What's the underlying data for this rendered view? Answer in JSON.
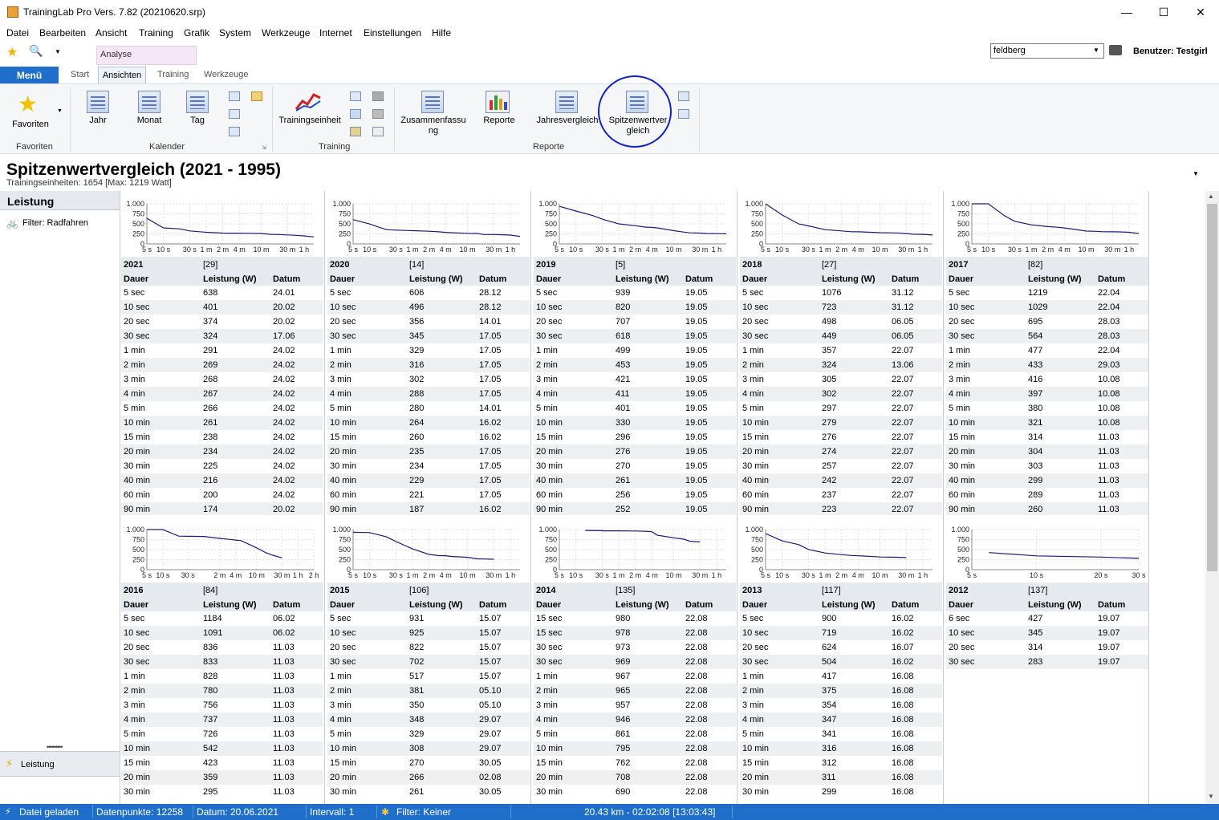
{
  "window": {
    "title": "TrainingLab Pro Vers. 7.82 (20210620.srp)"
  },
  "menu": [
    "Datei",
    "Bearbeiten",
    "Ansicht",
    "Training",
    "Grafik",
    "System",
    "Werkzeuge",
    "Internet",
    "Einstellungen",
    "Hilfe"
  ],
  "quick_access": {
    "context_tab": "Analyse"
  },
  "user": {
    "combo_value": "feldberg",
    "label": "Benutzer: Testgirl"
  },
  "tabs": {
    "menu": "Menü",
    "start": "Start",
    "ansichten": "Ansichten",
    "training": "Training",
    "werkzeuge": "Werkzeuge"
  },
  "ribbon": {
    "favoriten": "Favoriten",
    "favoriten_group": "Favoriten",
    "jahr": "Jahr",
    "monat": "Monat",
    "tag": "Tag",
    "kalender_group": "Kalender",
    "trainingseinheit": "Trainingseinheit",
    "training_group": "Training",
    "zusammenfassung_1": "Zusammenfassu",
    "zusammenfassung_2": "ng",
    "reporte": "Reporte",
    "jahresvergleich": "Jahresvergleich",
    "spitzen_1": "Spitzenwertver",
    "spitzen_2": "gleich",
    "reporte_group": "Reporte"
  },
  "page": {
    "title": "Spitzenwertvergleich (2021 - 1995)",
    "subtitle": "Trainingseinheiten: 1654 [Max: 1219 Watt]"
  },
  "sidebar": {
    "header": "Leistung",
    "filter": "Filter: Radfahren",
    "bottom": "Leistung"
  },
  "columns": {
    "dauer": "Dauer",
    "leistung": "Leistung (W)",
    "datum": "Datum"
  },
  "axis": {
    "y_ticks": [
      "1.000",
      "750",
      "500",
      "250",
      "0"
    ],
    "x_ticks": [
      "5 s",
      "10 s",
      "30 s",
      "1 m",
      "2 m",
      "4 m",
      "10 m",
      "30 m",
      "1 h"
    ],
    "x_ticks_2016": [
      "5 s",
      "10 s",
      "30 s",
      "2 m",
      "4 m",
      "10 m",
      "30 m",
      "1 h",
      "2 h"
    ],
    "x_ticks_2012": [
      "5 s",
      "10 s",
      "20 s",
      "30 s"
    ]
  },
  "cards": [
    {
      "year": "2021",
      "count": "[29]",
      "rows": [
        [
          "5 sec",
          "638",
          "24.01"
        ],
        [
          "10 sec",
          "401",
          "20.02"
        ],
        [
          "20 sec",
          "374",
          "20.02"
        ],
        [
          "30 sec",
          "324",
          "17.06"
        ],
        [
          "1 min",
          "291",
          "24.02"
        ],
        [
          "2 min",
          "269",
          "24.02"
        ],
        [
          "3 min",
          "268",
          "24.02"
        ],
        [
          "4 min",
          "267",
          "24.02"
        ],
        [
          "5 min",
          "266",
          "24.02"
        ],
        [
          "10 min",
          "261",
          "24.02"
        ],
        [
          "15 min",
          "238",
          "24.02"
        ],
        [
          "20 min",
          "234",
          "24.02"
        ],
        [
          "30 min",
          "225",
          "24.02"
        ],
        [
          "40 min",
          "216",
          "24.02"
        ],
        [
          "60 min",
          "200",
          "24.02"
        ],
        [
          "90 min",
          "174",
          "20.02"
        ]
      ]
    },
    {
      "year": "2020",
      "count": "[14]",
      "rows": [
        [
          "5 sec",
          "606",
          "28.12"
        ],
        [
          "10 sec",
          "496",
          "28.12"
        ],
        [
          "20 sec",
          "356",
          "14.01"
        ],
        [
          "30 sec",
          "345",
          "17.05"
        ],
        [
          "1 min",
          "329",
          "17.05"
        ],
        [
          "2 min",
          "316",
          "17.05"
        ],
        [
          "3 min",
          "302",
          "17.05"
        ],
        [
          "4 min",
          "288",
          "17.05"
        ],
        [
          "5 min",
          "280",
          "14.01"
        ],
        [
          "10 min",
          "264",
          "16.02"
        ],
        [
          "15 min",
          "260",
          "16.02"
        ],
        [
          "20 min",
          "235",
          "17.05"
        ],
        [
          "30 min",
          "234",
          "17.05"
        ],
        [
          "40 min",
          "229",
          "17.05"
        ],
        [
          "60 min",
          "221",
          "17.05"
        ],
        [
          "90 min",
          "187",
          "16.02"
        ]
      ]
    },
    {
      "year": "2019",
      "count": "[5]",
      "rows": [
        [
          "5 sec",
          "939",
          "19.05"
        ],
        [
          "10 sec",
          "820",
          "19.05"
        ],
        [
          "20 sec",
          "707",
          "19.05"
        ],
        [
          "30 sec",
          "618",
          "19.05"
        ],
        [
          "1 min",
          "499",
          "19.05"
        ],
        [
          "2 min",
          "453",
          "19.05"
        ],
        [
          "3 min",
          "421",
          "19.05"
        ],
        [
          "4 min",
          "411",
          "19.05"
        ],
        [
          "5 min",
          "401",
          "19.05"
        ],
        [
          "10 min",
          "330",
          "19.05"
        ],
        [
          "15 min",
          "296",
          "19.05"
        ],
        [
          "20 min",
          "276",
          "19.05"
        ],
        [
          "30 min",
          "270",
          "19.05"
        ],
        [
          "40 min",
          "261",
          "19.05"
        ],
        [
          "60 min",
          "256",
          "19.05"
        ],
        [
          "90 min",
          "252",
          "19.05"
        ]
      ]
    },
    {
      "year": "2018",
      "count": "[27]",
      "rows": [
        [
          "5 sec",
          "1076",
          "31.12"
        ],
        [
          "10 sec",
          "723",
          "31.12"
        ],
        [
          "20 sec",
          "498",
          "06.05"
        ],
        [
          "30 sec",
          "449",
          "06.05"
        ],
        [
          "1 min",
          "357",
          "22.07"
        ],
        [
          "2 min",
          "324",
          "13.06"
        ],
        [
          "3 min",
          "305",
          "22.07"
        ],
        [
          "4 min",
          "302",
          "22.07"
        ],
        [
          "5 min",
          "297",
          "22.07"
        ],
        [
          "10 min",
          "279",
          "22.07"
        ],
        [
          "15 min",
          "276",
          "22.07"
        ],
        [
          "20 min",
          "274",
          "22.07"
        ],
        [
          "30 min",
          "257",
          "22.07"
        ],
        [
          "40 min",
          "242",
          "22.07"
        ],
        [
          "60 min",
          "237",
          "22.07"
        ],
        [
          "90 min",
          "223",
          "22.07"
        ]
      ]
    },
    {
      "year": "2017",
      "count": "[82]",
      "rows": [
        [
          "5 sec",
          "1219",
          "22.04"
        ],
        [
          "10 sec",
          "1029",
          "22.04"
        ],
        [
          "20 sec",
          "695",
          "28.03"
        ],
        [
          "30 sec",
          "564",
          "28.03"
        ],
        [
          "1 min",
          "477",
          "22.04"
        ],
        [
          "2 min",
          "433",
          "29.03"
        ],
        [
          "3 min",
          "416",
          "10.08"
        ],
        [
          "4 min",
          "397",
          "10.08"
        ],
        [
          "5 min",
          "380",
          "10.08"
        ],
        [
          "10 min",
          "321",
          "10.08"
        ],
        [
          "15 min",
          "314",
          "11.03"
        ],
        [
          "20 min",
          "304",
          "11.03"
        ],
        [
          "30 min",
          "303",
          "11.03"
        ],
        [
          "40 min",
          "299",
          "11.03"
        ],
        [
          "60 min",
          "289",
          "11.03"
        ],
        [
          "90 min",
          "260",
          "11.03"
        ]
      ]
    },
    {
      "year": "2016",
      "count": "[84]",
      "rows": [
        [
          "5 sec",
          "1184",
          "06.02"
        ],
        [
          "10 sec",
          "1091",
          "06.02"
        ],
        [
          "20 sec",
          "836",
          "11.03"
        ],
        [
          "30 sec",
          "833",
          "11.03"
        ],
        [
          "1 min",
          "828",
          "11.03"
        ],
        [
          "2 min",
          "780",
          "11.03"
        ],
        [
          "3 min",
          "756",
          "11.03"
        ],
        [
          "4 min",
          "737",
          "11.03"
        ],
        [
          "5 min",
          "726",
          "11.03"
        ],
        [
          "10 min",
          "542",
          "11.03"
        ],
        [
          "15 min",
          "423",
          "11.03"
        ],
        [
          "20 min",
          "359",
          "11.03"
        ],
        [
          "30 min",
          "295",
          "11.03"
        ]
      ]
    },
    {
      "year": "2015",
      "count": "[106]",
      "rows": [
        [
          "5 sec",
          "931",
          "15.07"
        ],
        [
          "10 sec",
          "925",
          "15.07"
        ],
        [
          "20 sec",
          "822",
          "15.07"
        ],
        [
          "30 sec",
          "702",
          "15.07"
        ],
        [
          "1 min",
          "517",
          "15.07"
        ],
        [
          "2 min",
          "381",
          "05.10"
        ],
        [
          "3 min",
          "350",
          "05.10"
        ],
        [
          "4 min",
          "348",
          "29.07"
        ],
        [
          "5 min",
          "329",
          "29.07"
        ],
        [
          "10 min",
          "308",
          "29.07"
        ],
        [
          "15 min",
          "270",
          "30.05"
        ],
        [
          "20 min",
          "266",
          "02.08"
        ],
        [
          "30 min",
          "261",
          "30.05"
        ]
      ]
    },
    {
      "year": "2014",
      "count": "[135]",
      "rows": [
        [
          "15 sec",
          "980",
          "22.08"
        ],
        [
          "15 sec",
          "978",
          "22.08"
        ],
        [
          "30 sec",
          "973",
          "22.08"
        ],
        [
          "30 sec",
          "969",
          "22.08"
        ],
        [
          "1 min",
          "967",
          "22.08"
        ],
        [
          "2 min",
          "965",
          "22.08"
        ],
        [
          "3 min",
          "957",
          "22.08"
        ],
        [
          "4 min",
          "946",
          "22.08"
        ],
        [
          "5 min",
          "861",
          "22.08"
        ],
        [
          "10 min",
          "795",
          "22.08"
        ],
        [
          "15 min",
          "762",
          "22.08"
        ],
        [
          "20 min",
          "708",
          "22.08"
        ],
        [
          "30 min",
          "690",
          "22.08"
        ]
      ]
    },
    {
      "year": "2013",
      "count": "[117]",
      "rows": [
        [
          "5 sec",
          "900",
          "16.02"
        ],
        [
          "10 sec",
          "719",
          "16.02"
        ],
        [
          "20 sec",
          "624",
          "16.07"
        ],
        [
          "30 sec",
          "504",
          "16.02"
        ],
        [
          "1 min",
          "417",
          "16.08"
        ],
        [
          "2 min",
          "375",
          "16.08"
        ],
        [
          "3 min",
          "354",
          "16.08"
        ],
        [
          "4 min",
          "347",
          "16.08"
        ],
        [
          "5 min",
          "341",
          "16.08"
        ],
        [
          "10 min",
          "316",
          "16.08"
        ],
        [
          "15 min",
          "312",
          "16.08"
        ],
        [
          "20 min",
          "311",
          "16.08"
        ],
        [
          "30 min",
          "299",
          "16.08"
        ]
      ]
    },
    {
      "year": "2012",
      "count": "[137]",
      "rows": [
        [
          "6 sec",
          "427",
          "19.07"
        ],
        [
          "10 sec",
          "345",
          "19.07"
        ],
        [
          "20 sec",
          "314",
          "19.07"
        ],
        [
          "30 sec",
          "283",
          "19.07"
        ]
      ]
    }
  ],
  "status": {
    "loaded": "Datei geladen",
    "datapoints": "Datenpunkte: 12258",
    "date": "Datum: 20.06.2021",
    "interval": "Intervall: 1",
    "filter": "Filter: Keiner",
    "summary": "20.43 km - 02:02:08 [13:03:43]"
  },
  "colors": {
    "accent": "#1f6ec9",
    "chart_line": "#1a1a7a",
    "highlight": "#1023c4"
  }
}
